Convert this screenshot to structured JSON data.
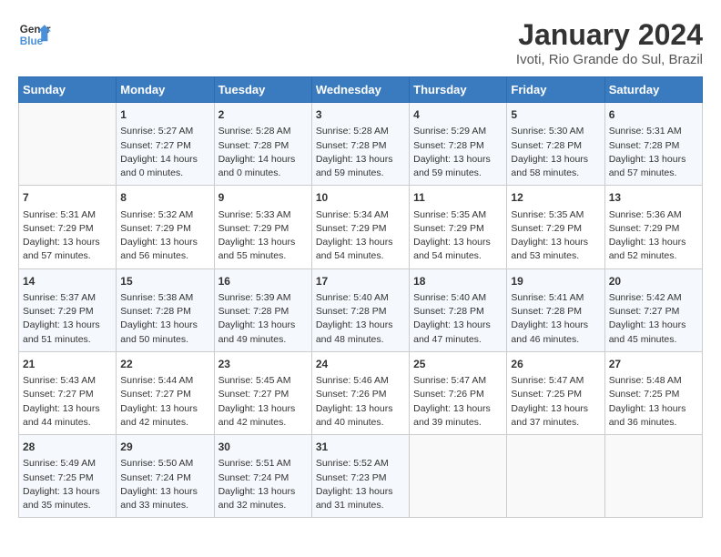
{
  "header": {
    "logo_line1": "General",
    "logo_line2": "Blue",
    "month": "January 2024",
    "location": "Ivoti, Rio Grande do Sul, Brazil"
  },
  "columns": [
    "Sunday",
    "Monday",
    "Tuesday",
    "Wednesday",
    "Thursday",
    "Friday",
    "Saturday"
  ],
  "weeks": [
    [
      {
        "day": "",
        "content": ""
      },
      {
        "day": "1",
        "content": "Sunrise: 5:27 AM\nSunset: 7:27 PM\nDaylight: 14 hours\nand 0 minutes."
      },
      {
        "day": "2",
        "content": "Sunrise: 5:28 AM\nSunset: 7:28 PM\nDaylight: 14 hours\nand 0 minutes."
      },
      {
        "day": "3",
        "content": "Sunrise: 5:28 AM\nSunset: 7:28 PM\nDaylight: 13 hours\nand 59 minutes."
      },
      {
        "day": "4",
        "content": "Sunrise: 5:29 AM\nSunset: 7:28 PM\nDaylight: 13 hours\nand 59 minutes."
      },
      {
        "day": "5",
        "content": "Sunrise: 5:30 AM\nSunset: 7:28 PM\nDaylight: 13 hours\nand 58 minutes."
      },
      {
        "day": "6",
        "content": "Sunrise: 5:31 AM\nSunset: 7:28 PM\nDaylight: 13 hours\nand 57 minutes."
      }
    ],
    [
      {
        "day": "7",
        "content": "Sunrise: 5:31 AM\nSunset: 7:29 PM\nDaylight: 13 hours\nand 57 minutes."
      },
      {
        "day": "8",
        "content": "Sunrise: 5:32 AM\nSunset: 7:29 PM\nDaylight: 13 hours\nand 56 minutes."
      },
      {
        "day": "9",
        "content": "Sunrise: 5:33 AM\nSunset: 7:29 PM\nDaylight: 13 hours\nand 55 minutes."
      },
      {
        "day": "10",
        "content": "Sunrise: 5:34 AM\nSunset: 7:29 PM\nDaylight: 13 hours\nand 54 minutes."
      },
      {
        "day": "11",
        "content": "Sunrise: 5:35 AM\nSunset: 7:29 PM\nDaylight: 13 hours\nand 54 minutes."
      },
      {
        "day": "12",
        "content": "Sunrise: 5:35 AM\nSunset: 7:29 PM\nDaylight: 13 hours\nand 53 minutes."
      },
      {
        "day": "13",
        "content": "Sunrise: 5:36 AM\nSunset: 7:29 PM\nDaylight: 13 hours\nand 52 minutes."
      }
    ],
    [
      {
        "day": "14",
        "content": "Sunrise: 5:37 AM\nSunset: 7:29 PM\nDaylight: 13 hours\nand 51 minutes."
      },
      {
        "day": "15",
        "content": "Sunrise: 5:38 AM\nSunset: 7:28 PM\nDaylight: 13 hours\nand 50 minutes."
      },
      {
        "day": "16",
        "content": "Sunrise: 5:39 AM\nSunset: 7:28 PM\nDaylight: 13 hours\nand 49 minutes."
      },
      {
        "day": "17",
        "content": "Sunrise: 5:40 AM\nSunset: 7:28 PM\nDaylight: 13 hours\nand 48 minutes."
      },
      {
        "day": "18",
        "content": "Sunrise: 5:40 AM\nSunset: 7:28 PM\nDaylight: 13 hours\nand 47 minutes."
      },
      {
        "day": "19",
        "content": "Sunrise: 5:41 AM\nSunset: 7:28 PM\nDaylight: 13 hours\nand 46 minutes."
      },
      {
        "day": "20",
        "content": "Sunrise: 5:42 AM\nSunset: 7:27 PM\nDaylight: 13 hours\nand 45 minutes."
      }
    ],
    [
      {
        "day": "21",
        "content": "Sunrise: 5:43 AM\nSunset: 7:27 PM\nDaylight: 13 hours\nand 44 minutes."
      },
      {
        "day": "22",
        "content": "Sunrise: 5:44 AM\nSunset: 7:27 PM\nDaylight: 13 hours\nand 42 minutes."
      },
      {
        "day": "23",
        "content": "Sunrise: 5:45 AM\nSunset: 7:27 PM\nDaylight: 13 hours\nand 42 minutes."
      },
      {
        "day": "24",
        "content": "Sunrise: 5:46 AM\nSunset: 7:26 PM\nDaylight: 13 hours\nand 40 minutes."
      },
      {
        "day": "25",
        "content": "Sunrise: 5:47 AM\nSunset: 7:26 PM\nDaylight: 13 hours\nand 39 minutes."
      },
      {
        "day": "26",
        "content": "Sunrise: 5:47 AM\nSunset: 7:25 PM\nDaylight: 13 hours\nand 37 minutes."
      },
      {
        "day": "27",
        "content": "Sunrise: 5:48 AM\nSunset: 7:25 PM\nDaylight: 13 hours\nand 36 minutes."
      }
    ],
    [
      {
        "day": "28",
        "content": "Sunrise: 5:49 AM\nSunset: 7:25 PM\nDaylight: 13 hours\nand 35 minutes."
      },
      {
        "day": "29",
        "content": "Sunrise: 5:50 AM\nSunset: 7:24 PM\nDaylight: 13 hours\nand 33 minutes."
      },
      {
        "day": "30",
        "content": "Sunrise: 5:51 AM\nSunset: 7:24 PM\nDaylight: 13 hours\nand 32 minutes."
      },
      {
        "day": "31",
        "content": "Sunrise: 5:52 AM\nSunset: 7:23 PM\nDaylight: 13 hours\nand 31 minutes."
      },
      {
        "day": "",
        "content": ""
      },
      {
        "day": "",
        "content": ""
      },
      {
        "day": "",
        "content": ""
      }
    ]
  ]
}
